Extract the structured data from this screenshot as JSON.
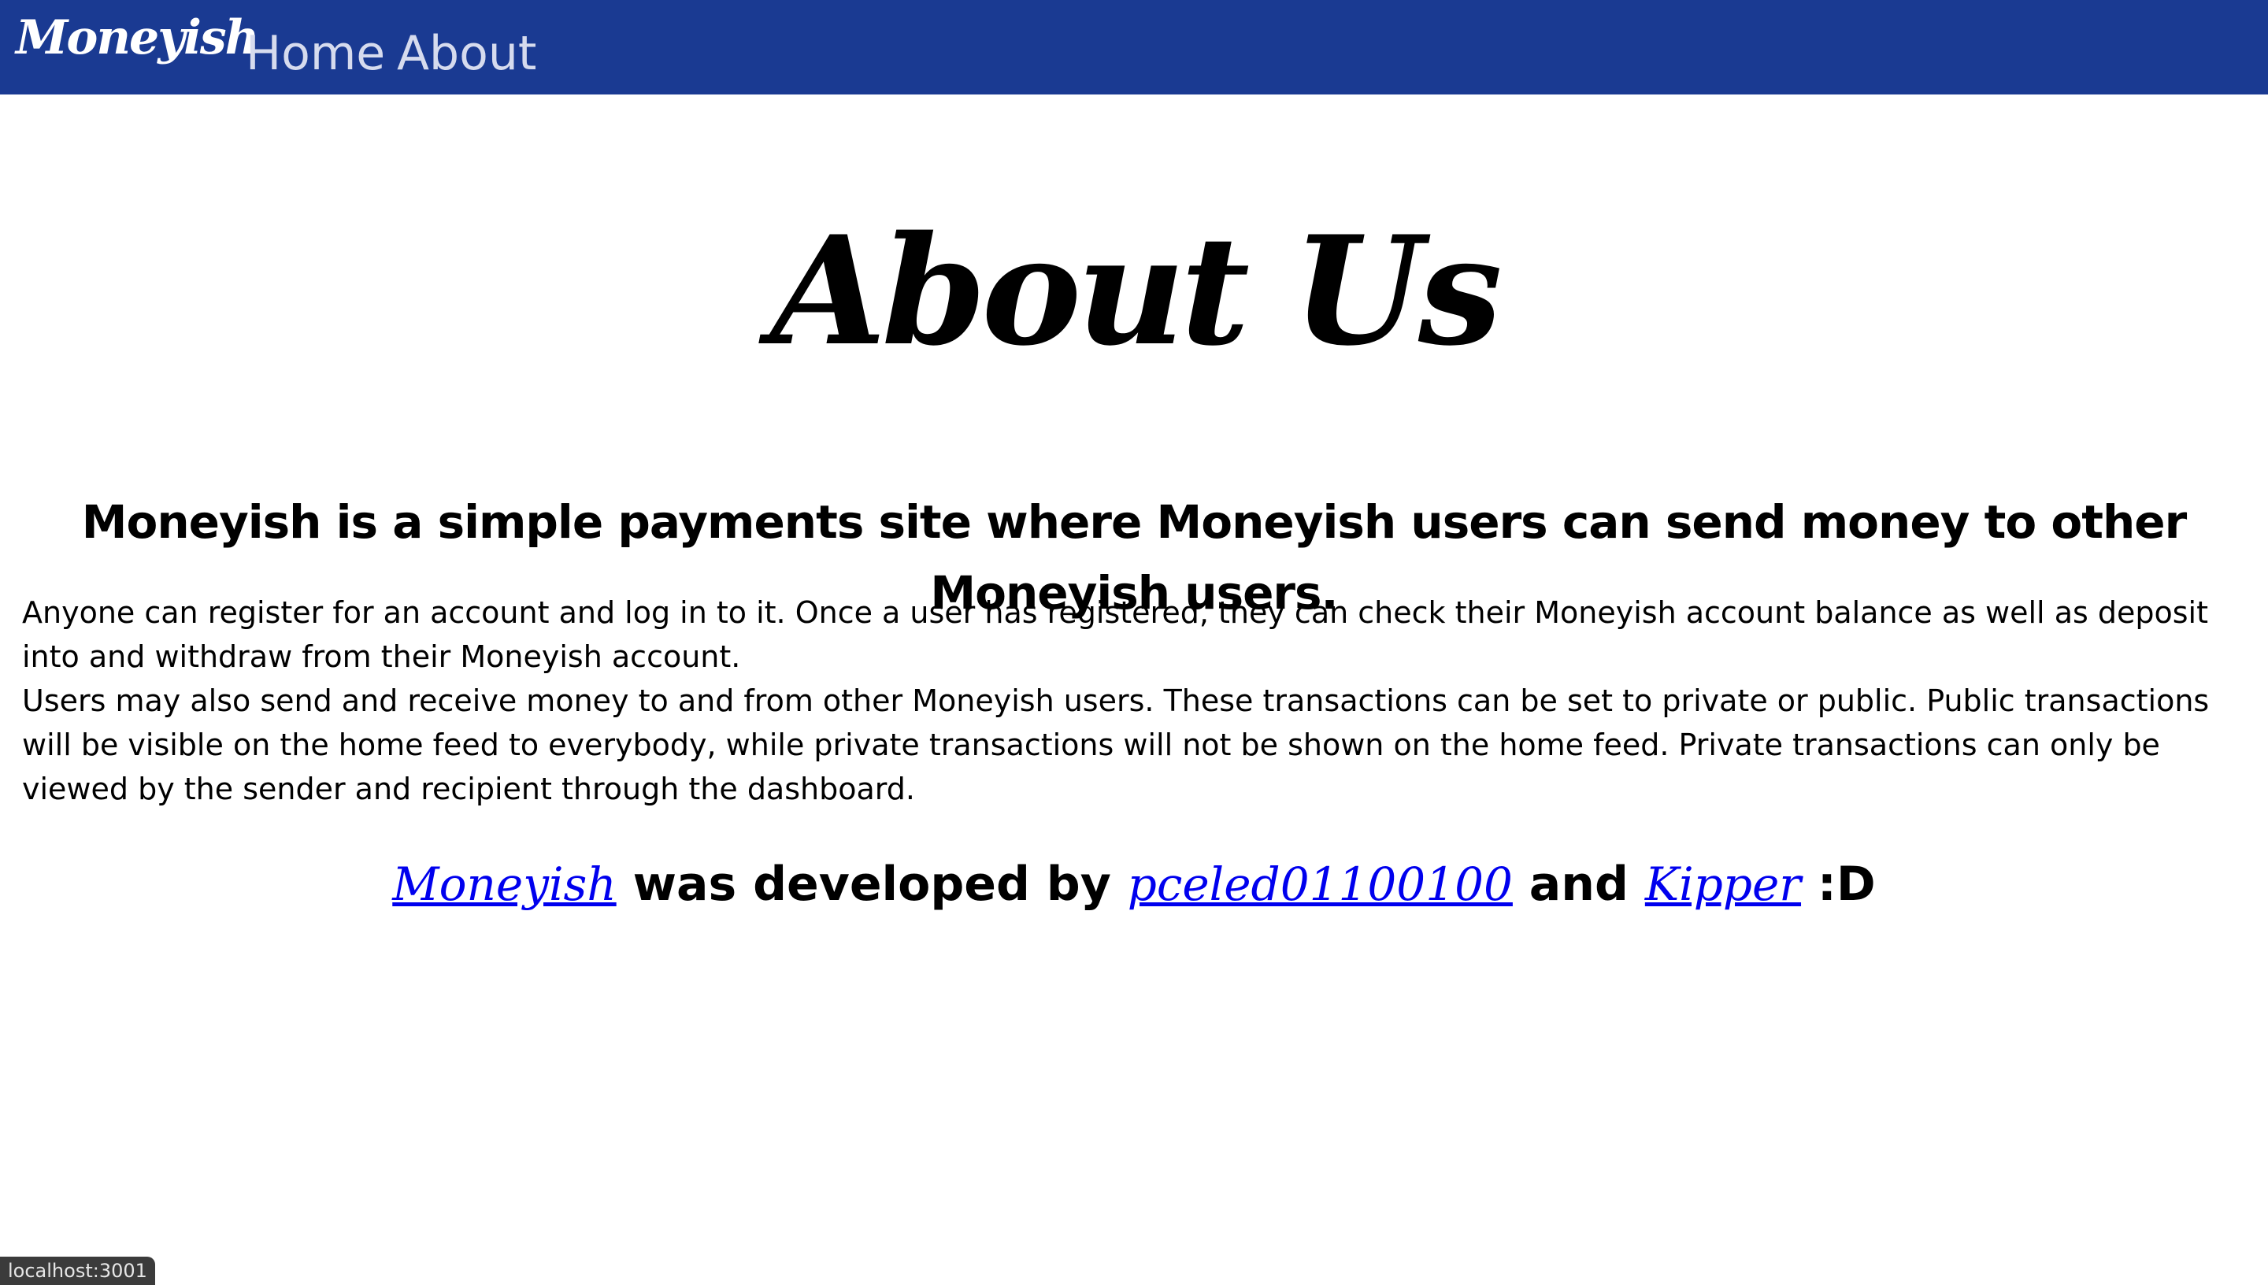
{
  "navbar": {
    "brand": "Moneyish",
    "links": [
      "Home",
      "About"
    ]
  },
  "main": {
    "title": "About Us",
    "tagline": "Moneyish is a simple payments site where Moneyish users can send money to other Moneyish users.",
    "paragraph1": "Anyone can register for an account and log in to it. Once a user has registered, they can check their Moneyish account balance as well as deposit into and withdraw from their Moneyish account.",
    "paragraph2": "Users may also send and receive money to and from other Moneyish users. These transactions can be set to private or public. Public transactions will be visible on the home feed to everybody, while private transactions will not be shown on the home feed. Private transactions can only be viewed by the sender and recipient through the dashboard.",
    "credits": {
      "project_link": "Moneyish",
      "text1": "was developed by",
      "author1": "pceled01100100",
      "text2": "and",
      "author2": "Kipper",
      "suffix": ":D"
    }
  },
  "status_bar": {
    "url": "localhost:3001"
  },
  "colors": {
    "navbar_bg": "#1a3a92",
    "link": "#0000ee"
  }
}
